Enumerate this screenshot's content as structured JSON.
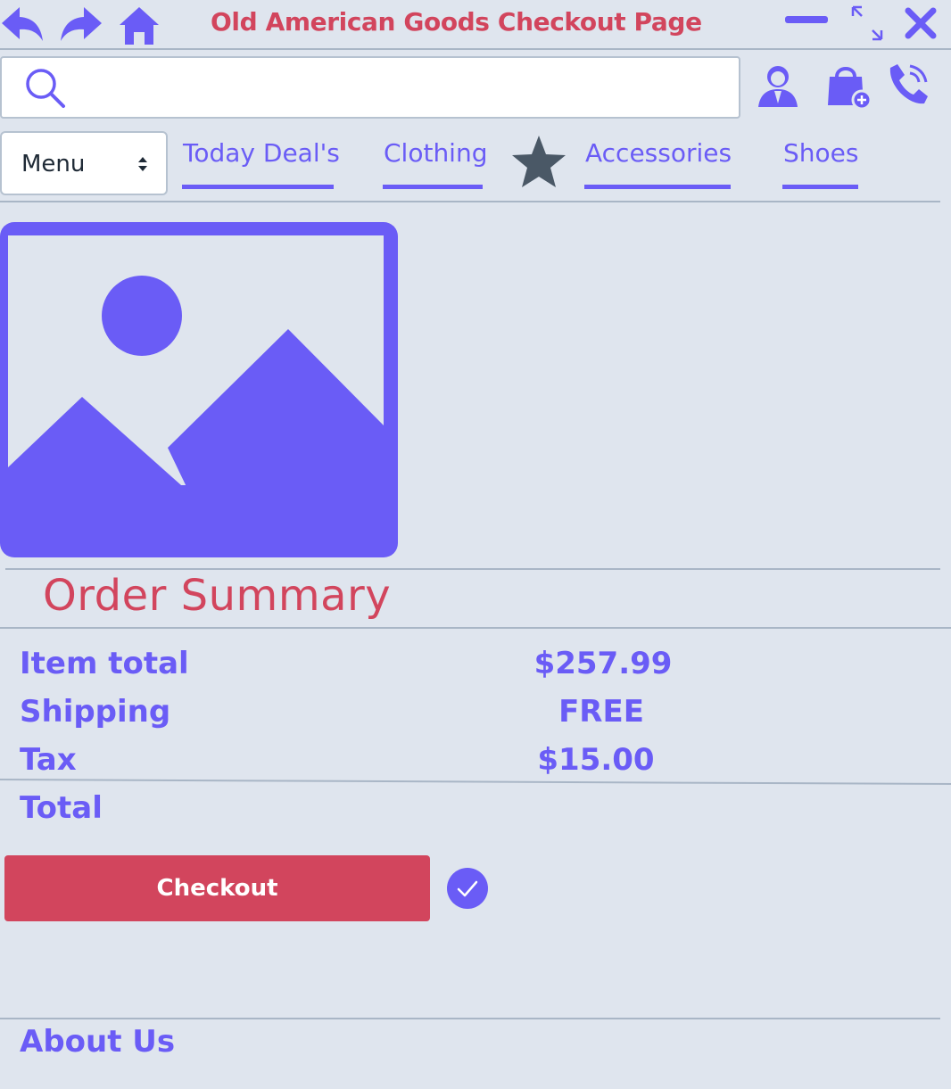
{
  "window": {
    "title": "Old American Goods Checkout Page",
    "icons": [
      "back-arrow-icon",
      "forward-arrow-icon",
      "home-icon",
      "minimize-icon",
      "maximize-icon",
      "close-icon"
    ]
  },
  "header": {
    "search_placeholder": "",
    "icons": [
      "search-icon",
      "user-icon",
      "shopping-bag-add-icon",
      "phone-call-icon"
    ]
  },
  "nav": {
    "menu_select": "Menu",
    "links": [
      "Today Deal's",
      "Clothing",
      "Accessories",
      "Shoes"
    ],
    "star_icon": "star-icon"
  },
  "product": {
    "image_icon": "image-placeholder-icon"
  },
  "summary": {
    "title": "Order Summary",
    "rows": [
      {
        "label": "Item total",
        "value": "$257.99"
      },
      {
        "label": "Shipping",
        "value": "FREE"
      },
      {
        "label": "Tax",
        "value": "$15.00"
      }
    ],
    "total_label": "Total",
    "total_value": ""
  },
  "actions": {
    "checkout_label": "Checkout",
    "confirm_icon": "check-circle-icon"
  },
  "footer": {
    "about": "About Us"
  },
  "colors": {
    "accent": "#6a5cf6",
    "brand_red": "#d2455d",
    "background": "#dfe5ee",
    "star": "#4a5866"
  }
}
